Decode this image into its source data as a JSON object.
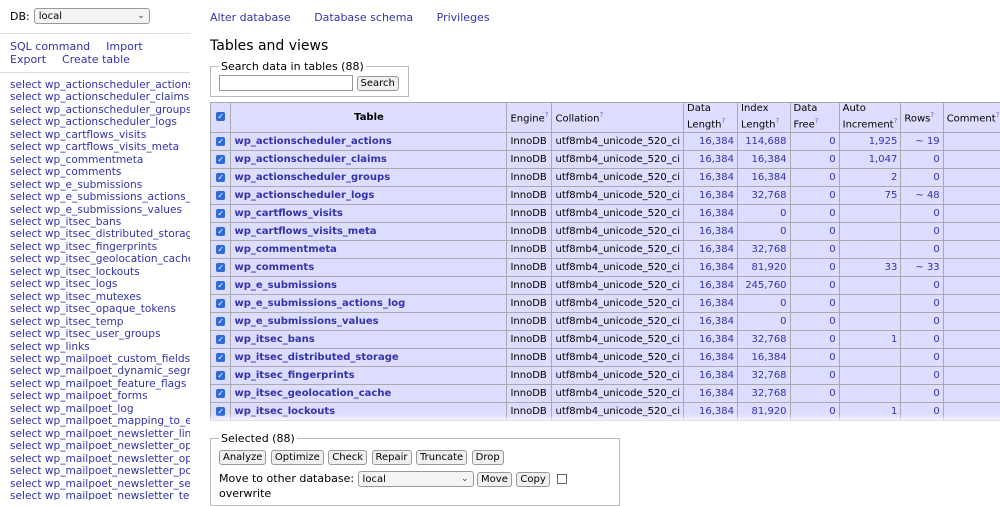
{
  "sidebar": {
    "db_label": "DB:",
    "db_value": "local",
    "links": [
      "SQL command",
      "Import",
      "Export",
      "Create table"
    ],
    "tables": [
      "select wp_actionscheduler_actions",
      "select wp_actionscheduler_claims",
      "select wp_actionscheduler_groups",
      "select wp_actionscheduler_logs",
      "select wp_cartflows_visits",
      "select wp_cartflows_visits_meta",
      "select wp_commentmeta",
      "select wp_comments",
      "select wp_e_submissions",
      "select wp_e_submissions_actions_log",
      "select wp_e_submissions_values",
      "select wp_itsec_bans",
      "select wp_itsec_distributed_storage",
      "select wp_itsec_fingerprints",
      "select wp_itsec_geolocation_cache",
      "select wp_itsec_lockouts",
      "select wp_itsec_logs",
      "select wp_itsec_mutexes",
      "select wp_itsec_opaque_tokens",
      "select wp_itsec_temp",
      "select wp_itsec_user_groups",
      "select wp_links",
      "select wp_mailpoet_custom_fields",
      "select wp_mailpoet_dynamic_segments",
      "select wp_mailpoet_feature_flags",
      "select wp_mailpoet_forms",
      "select wp_mailpoet_log",
      "select wp_mailpoet_mapping_to_external_entities",
      "select wp_mailpoet_newsletter_links",
      "select wp_mailpoet_newsletter_option",
      "select wp_mailpoet_newsletter_option_fields",
      "select wp_mailpoet_newsletter_posts",
      "select wp_mailpoet_newsletter_segment",
      "select wp_mailpoet_newsletter_templates"
    ]
  },
  "top_links": [
    "Alter database",
    "Database schema",
    "Privileges"
  ],
  "title": "Tables and views",
  "search": {
    "legend": "Search data in tables (88)",
    "value": "",
    "button": "Search"
  },
  "table": {
    "headers": [
      "Table",
      "Engine",
      "Collation",
      "Data Length",
      "Index Length",
      "Data Free",
      "Auto Increment",
      "Rows",
      "Comment"
    ],
    "help_mark": "?",
    "rows": [
      {
        "name": "wp_actionscheduler_actions",
        "engine": "InnoDB",
        "collation": "utf8mb4_unicode_520_ci",
        "data_length": "16,384",
        "index_length": "114,688",
        "data_free": "0",
        "auto_increment": "1,925",
        "rows": "~ 19",
        "comment": ""
      },
      {
        "name": "wp_actionscheduler_claims",
        "engine": "InnoDB",
        "collation": "utf8mb4_unicode_520_ci",
        "data_length": "16,384",
        "index_length": "16,384",
        "data_free": "0",
        "auto_increment": "1,047",
        "rows": "0",
        "comment": ""
      },
      {
        "name": "wp_actionscheduler_groups",
        "engine": "InnoDB",
        "collation": "utf8mb4_unicode_520_ci",
        "data_length": "16,384",
        "index_length": "16,384",
        "data_free": "0",
        "auto_increment": "2",
        "rows": "0",
        "comment": ""
      },
      {
        "name": "wp_actionscheduler_logs",
        "engine": "InnoDB",
        "collation": "utf8mb4_unicode_520_ci",
        "data_length": "16,384",
        "index_length": "32,768",
        "data_free": "0",
        "auto_increment": "75",
        "rows": "~ 48",
        "comment": ""
      },
      {
        "name": "wp_cartflows_visits",
        "engine": "InnoDB",
        "collation": "utf8mb4_unicode_520_ci",
        "data_length": "16,384",
        "index_length": "0",
        "data_free": "0",
        "auto_increment": "",
        "rows": "0",
        "comment": ""
      },
      {
        "name": "wp_cartflows_visits_meta",
        "engine": "InnoDB",
        "collation": "utf8mb4_unicode_520_ci",
        "data_length": "16,384",
        "index_length": "0",
        "data_free": "0",
        "auto_increment": "",
        "rows": "0",
        "comment": ""
      },
      {
        "name": "wp_commentmeta",
        "engine": "InnoDB",
        "collation": "utf8mb4_unicode_520_ci",
        "data_length": "16,384",
        "index_length": "32,768",
        "data_free": "0",
        "auto_increment": "",
        "rows": "0",
        "comment": ""
      },
      {
        "name": "wp_comments",
        "engine": "InnoDB",
        "collation": "utf8mb4_unicode_520_ci",
        "data_length": "16,384",
        "index_length": "81,920",
        "data_free": "0",
        "auto_increment": "33",
        "rows": "~ 33",
        "comment": ""
      },
      {
        "name": "wp_e_submissions",
        "engine": "InnoDB",
        "collation": "utf8mb4_unicode_520_ci",
        "data_length": "16,384",
        "index_length": "245,760",
        "data_free": "0",
        "auto_increment": "",
        "rows": "0",
        "comment": ""
      },
      {
        "name": "wp_e_submissions_actions_log",
        "engine": "InnoDB",
        "collation": "utf8mb4_unicode_520_ci",
        "data_length": "16,384",
        "index_length": "0",
        "data_free": "0",
        "auto_increment": "",
        "rows": "0",
        "comment": ""
      },
      {
        "name": "wp_e_submissions_values",
        "engine": "InnoDB",
        "collation": "utf8mb4_unicode_520_ci",
        "data_length": "16,384",
        "index_length": "0",
        "data_free": "0",
        "auto_increment": "",
        "rows": "0",
        "comment": ""
      },
      {
        "name": "wp_itsec_bans",
        "engine": "InnoDB",
        "collation": "utf8mb4_unicode_520_ci",
        "data_length": "16,384",
        "index_length": "32,768",
        "data_free": "0",
        "auto_increment": "1",
        "rows": "0",
        "comment": ""
      },
      {
        "name": "wp_itsec_distributed_storage",
        "engine": "InnoDB",
        "collation": "utf8mb4_unicode_520_ci",
        "data_length": "16,384",
        "index_length": "16,384",
        "data_free": "0",
        "auto_increment": "",
        "rows": "0",
        "comment": ""
      },
      {
        "name": "wp_itsec_fingerprints",
        "engine": "InnoDB",
        "collation": "utf8mb4_unicode_520_ci",
        "data_length": "16,384",
        "index_length": "32,768",
        "data_free": "0",
        "auto_increment": "",
        "rows": "0",
        "comment": ""
      },
      {
        "name": "wp_itsec_geolocation_cache",
        "engine": "InnoDB",
        "collation": "utf8mb4_unicode_520_ci",
        "data_length": "16,384",
        "index_length": "32,768",
        "data_free": "0",
        "auto_increment": "",
        "rows": "0",
        "comment": ""
      },
      {
        "name": "wp_itsec_lockouts",
        "engine": "InnoDB",
        "collation": "utf8mb4_unicode_520_ci",
        "data_length": "16,384",
        "index_length": "81,920",
        "data_free": "0",
        "auto_increment": "1",
        "rows": "0",
        "comment": ""
      }
    ]
  },
  "selected": {
    "legend": "Selected (88)",
    "buttons": [
      "Analyze",
      "Optimize",
      "Check",
      "Repair",
      "Truncate",
      "Drop"
    ],
    "move_label": "Move to other database:",
    "move_db": "local",
    "move_button": "Move",
    "copy_button": "Copy",
    "overwrite_label": "overwrite"
  }
}
